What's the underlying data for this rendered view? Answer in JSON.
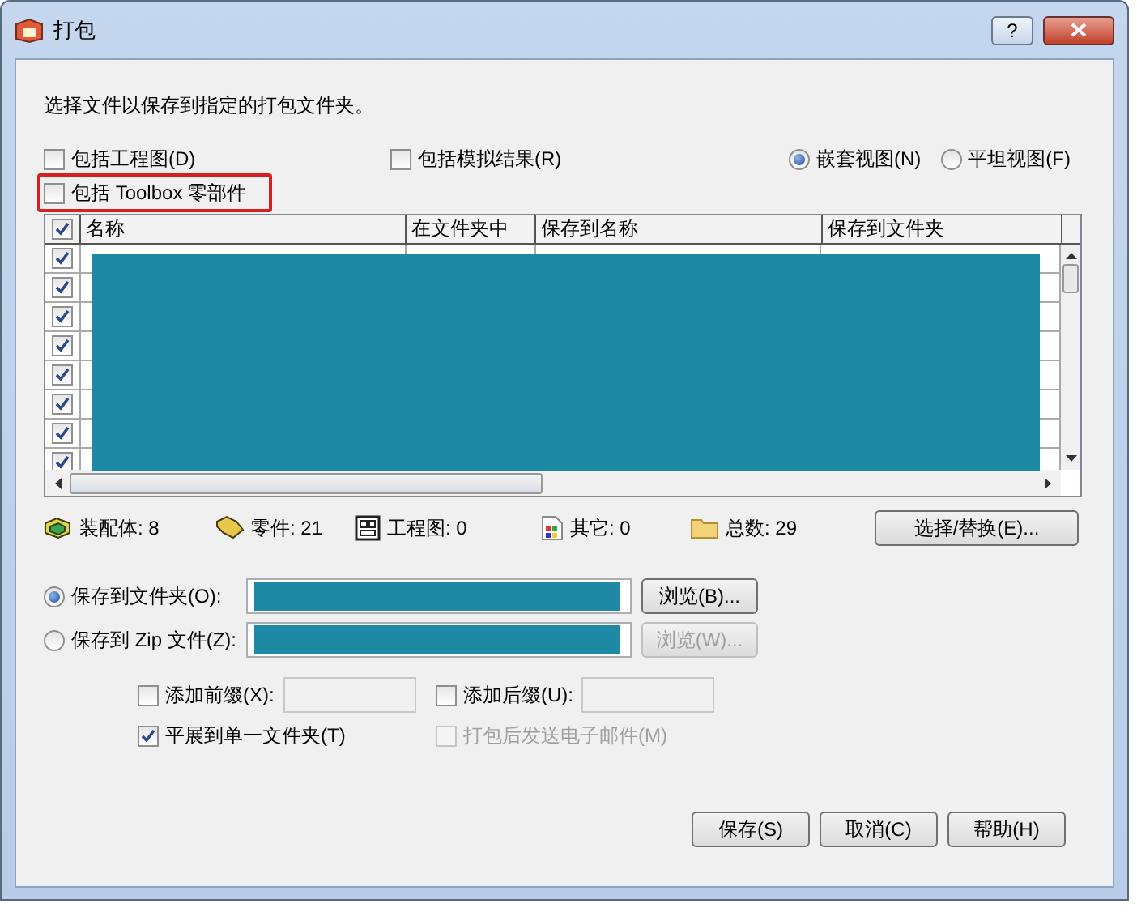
{
  "window": {
    "title": "打包",
    "help_glyph": "?"
  },
  "instruction": "选择文件以保存到指定的打包文件夹。",
  "options": [
    {
      "label": "包括工程图(D)",
      "checked": false,
      "highlighted": false
    },
    {
      "label": "包括模拟结果(R)",
      "checked": false,
      "highlighted": false
    },
    {
      "label": "包括 Toolbox 零部件",
      "checked": false,
      "highlighted": true
    }
  ],
  "view_modes": [
    {
      "label": "嵌套视图(N)",
      "selected": true
    },
    {
      "label": "平坦视图(F)",
      "selected": false
    }
  ],
  "table": {
    "all_checked": true,
    "columns": [
      "名称",
      "在文件夹中",
      "保存到名称",
      "保存到文件夹"
    ],
    "rows": [
      {
        "checked": true
      },
      {
        "checked": true
      },
      {
        "checked": true
      },
      {
        "checked": true
      },
      {
        "checked": true
      },
      {
        "checked": true
      },
      {
        "checked": true
      },
      {
        "checked": true
      }
    ]
  },
  "summary": [
    {
      "kind": "assembly",
      "label": "装配体: 8"
    },
    {
      "kind": "part",
      "label": "零件: 21"
    },
    {
      "kind": "drawing",
      "label": "工程图: 0"
    },
    {
      "kind": "other",
      "label": "其它: 0"
    },
    {
      "kind": "total",
      "label": "总数: 29"
    }
  ],
  "select_replace_button": "选择/替换(E)...",
  "save_targets": [
    {
      "label": "保存到文件夹(O):",
      "selected": true,
      "browse": "浏览(B)...",
      "browse_disabled": false
    },
    {
      "label": "保存到 Zip 文件(Z):",
      "selected": false,
      "browse": "浏览(W)...",
      "browse_disabled": true
    }
  ],
  "affixes": [
    {
      "label": "添加前缀(X):",
      "checked": false
    },
    {
      "label": "添加后缀(U):",
      "checked": false
    }
  ],
  "flatten": {
    "label": "平展到单一文件夹(T)",
    "checked": true,
    "disabled": false
  },
  "email": {
    "label": "打包后发送电子邮件(M)",
    "checked": false,
    "disabled": true
  },
  "buttons": [
    "保存(S)",
    "取消(C)",
    "帮助(H)"
  ]
}
